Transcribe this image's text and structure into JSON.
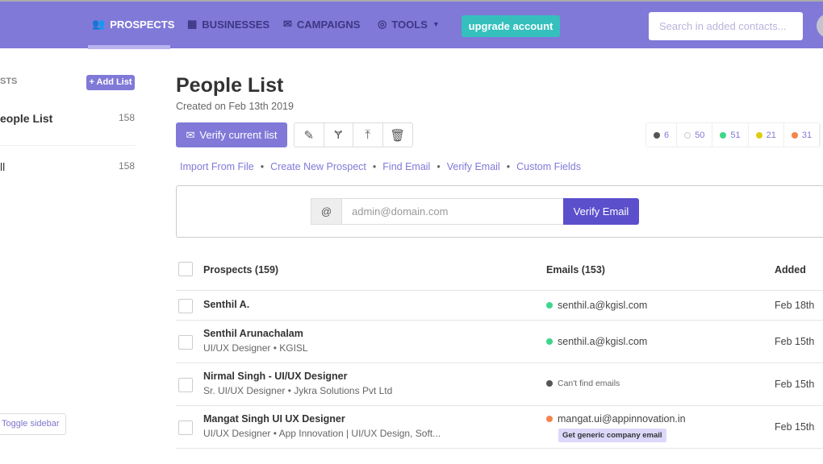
{
  "nav": {
    "items": [
      {
        "label": "PROSPECTS",
        "icon": "people-icon"
      },
      {
        "label": "BUSINESSES",
        "icon": "building-icon"
      },
      {
        "label": "CAMPAIGNS",
        "icon": "envelope-icon"
      },
      {
        "label": "TOOLS",
        "icon": "target-icon"
      }
    ],
    "upgrade": "upgrade account",
    "search_placeholder": "Search in added contacts..."
  },
  "sidebar": {
    "heading": "STS",
    "add_list": "+ Add List",
    "lists": [
      {
        "name": "eople List",
        "count": "158"
      },
      {
        "name": "ll",
        "count": "158"
      }
    ],
    "toggle": "Toggle sidebar"
  },
  "main": {
    "title": "People List",
    "created": "Created on Feb 13th 2019",
    "verify_list": "Verify current list",
    "stats": [
      {
        "color": "#555555",
        "value": "6"
      },
      {
        "color": "#cccccc",
        "value": "50"
      },
      {
        "color": "#3dd68c",
        "value": "51"
      },
      {
        "color": "#e0cc10",
        "value": "21"
      },
      {
        "color": "#f5844c",
        "value": "31"
      }
    ],
    "links": [
      "Import From File",
      "Create New Prospect",
      "Find Email",
      "Verify Email",
      "Custom Fields"
    ],
    "verify": {
      "at": "@",
      "placeholder": "admin@domain.com",
      "button": "Verify Email"
    },
    "table": {
      "headers": [
        "Prospects (159)",
        "Emails (153)",
        "Added"
      ],
      "rows": [
        {
          "name": "Senthil A.",
          "sub": "",
          "email": "senthil.a@kgisl.com",
          "status": "#3dd68c",
          "added": "Feb 18th"
        },
        {
          "name": "Senthil Arunachalam",
          "sub": "UI/UX Designer • KGISL",
          "email": "senthil.a@kgisl.com",
          "status": "#3dd68c",
          "added": "Feb 15th"
        },
        {
          "name": "Nirmal Singh - UI/UX Designer",
          "sub": "Sr. UI/UX Designer • Jykra Solutions Pvt Ltd",
          "email": "Can't find emails",
          "status": "#555555",
          "added": "Feb 15th"
        },
        {
          "name": "Mangat Singh UI UX Designer",
          "sub": "UI/UX Designer • App Innovation | UI/UX Design, Soft...",
          "email": "mangat.ui@appinnovation.in",
          "status": "#f5844c",
          "added": "Feb 15th",
          "badge": "Get generic company email"
        }
      ]
    }
  }
}
